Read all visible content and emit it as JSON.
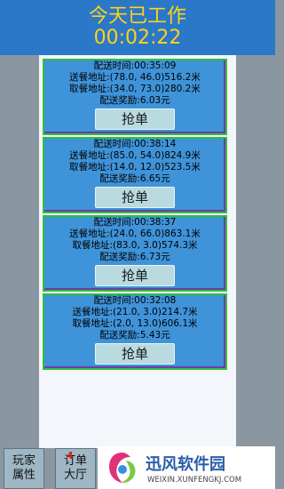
{
  "header": {
    "title": "今天已工作",
    "elapsed": "00:02:22"
  },
  "orders": [
    {
      "time_line": "配送时间:00:35:09",
      "send_line": "送餐地址:(78.0, 46.0)516.2米",
      "pickup_line": "取餐地址:(34.0, 73.0)280.2米",
      "reward_line": "配送奖励:6.03元",
      "button": "抢单"
    },
    {
      "time_line": "配送时间:00:38:14",
      "send_line": "送餐地址:(85.0, 54.0)824.9米",
      "pickup_line": "取餐地址:(14.0, 12.0)523.5米",
      "reward_line": "配送奖励:6.65元",
      "button": "抢单"
    },
    {
      "time_line": "配送时间:00:38:37",
      "send_line": "送餐地址:(24.0, 66.0)863.1米",
      "pickup_line": "取餐地址:(83.0, 3.0)574.3米",
      "reward_line": "配送奖励:6.73元",
      "button": "抢单"
    },
    {
      "time_line": "配送时间:00:32:08",
      "send_line": "送餐地址:(21.0, 3.0)214.7米",
      "pickup_line": "取餐地址:(2.0, 13.0)606.1米",
      "reward_line": "配送奖励:5.43元",
      "button": "抢单"
    }
  ],
  "tabs": {
    "player": {
      "line1": "玩家",
      "line2": "属性"
    },
    "orders": {
      "line1": "订单",
      "line2": "大厅",
      "badge": "4"
    }
  },
  "watermark": {
    "name": "迅风软件园",
    "url": "WEIXIN.XUNFENGKJ.COM"
  },
  "colors": {
    "header_bg": "#2b78c8",
    "header_text": "#ffd21a",
    "card_bg": "#3f93d9",
    "card_border": "#2fbf3d",
    "button_bg": "#b9dbe0"
  }
}
